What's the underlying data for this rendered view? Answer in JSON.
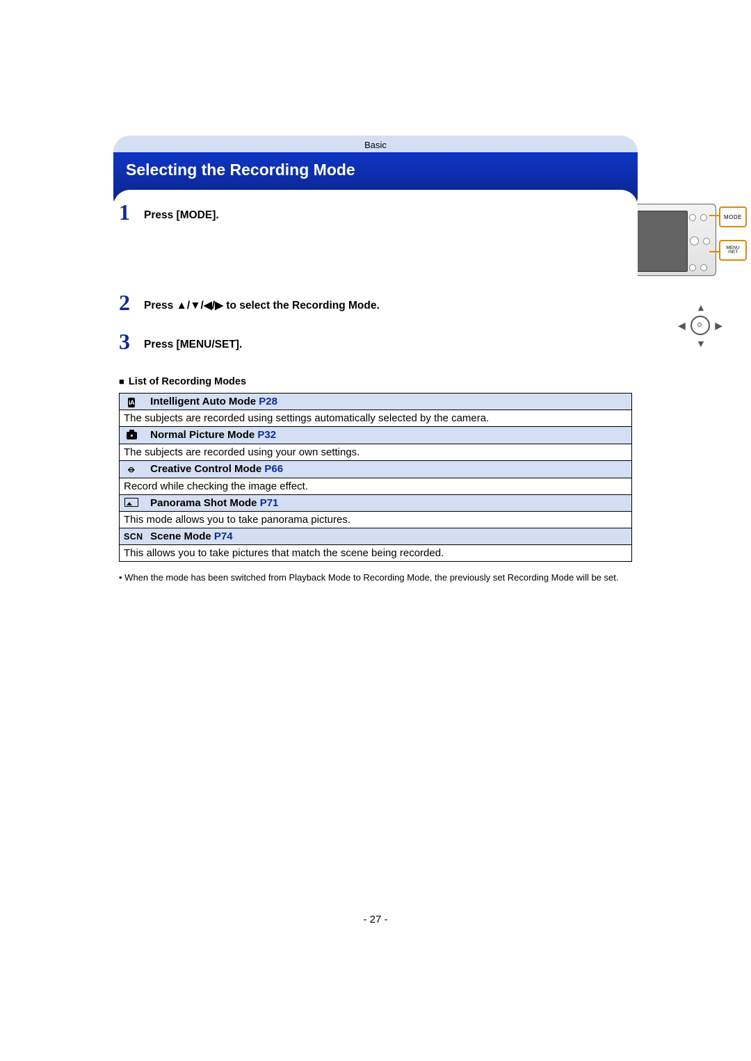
{
  "header": {
    "category": "Basic"
  },
  "section_title": "Selecting the Recording Mode",
  "steps": [
    {
      "num": "1",
      "text_a": "Press [MODE].",
      "text_b": ""
    },
    {
      "num": "2",
      "text_a": "Press ",
      "text_b": " to select the Recording Mode."
    },
    {
      "num": "3",
      "text_a": "Press [MENU/SET].",
      "text_b": ""
    }
  ],
  "arrows_glyph": "▲/▼/◀/▶",
  "illustration": {
    "mode_label": "MODE",
    "menuset_line1": "MENU",
    "menuset_line2": "/SET"
  },
  "list_heading": "List of Recording Modes",
  "modes": [
    {
      "icon": "iA",
      "title": "Intelligent Auto Mode",
      "page": "P28",
      "desc": "The subjects are recorded using settings automatically selected by the camera."
    },
    {
      "icon": "camera",
      "title": "Normal Picture Mode",
      "page": "P32",
      "desc": "The subjects are recorded using your own settings."
    },
    {
      "icon": "palette",
      "title": "Creative Control Mode",
      "page": "P66",
      "desc": "Record while checking the image effect."
    },
    {
      "icon": "panorama",
      "title": "Panorama Shot Mode",
      "page": "P71",
      "desc": "This mode allows you to take panorama pictures."
    },
    {
      "icon": "SCN",
      "title": "Scene Mode",
      "page": "P74",
      "desc": "This allows you to take pictures that match the scene being recorded."
    }
  ],
  "footnote": "When the mode has been switched from Playback Mode to Recording Mode, the previously set Recording Mode will be set.",
  "page_number": "- 27 -"
}
